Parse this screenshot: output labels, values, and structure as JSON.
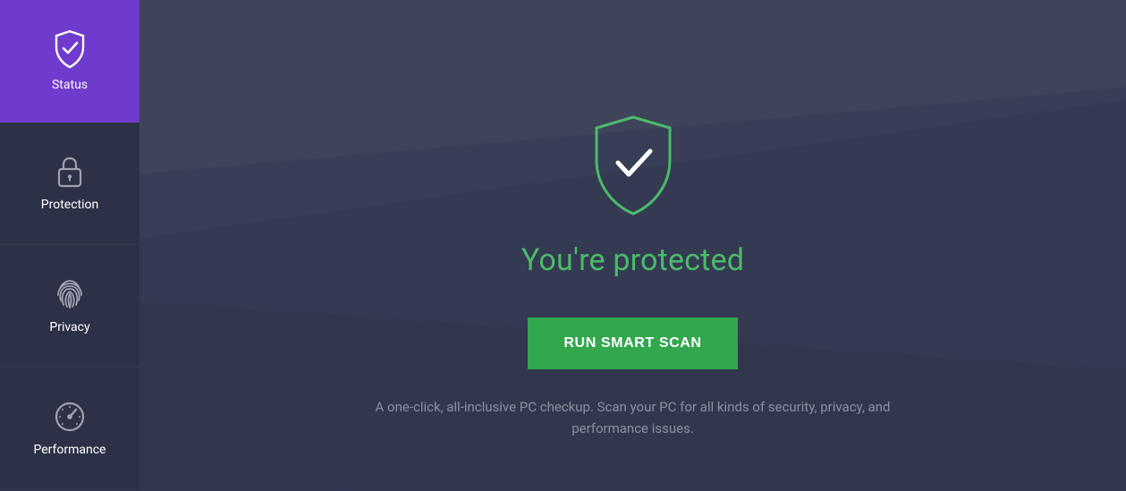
{
  "sidebar": {
    "items": [
      {
        "label": "Status",
        "icon": "shield-check-icon",
        "active": true
      },
      {
        "label": "Protection",
        "icon": "lock-icon",
        "active": false
      },
      {
        "label": "Privacy",
        "icon": "fingerprint-icon",
        "active": false
      },
      {
        "label": "Performance",
        "icon": "gauge-icon",
        "active": false
      }
    ]
  },
  "main": {
    "status_title": "You're protected",
    "scan_button_label": "RUN SMART SCAN",
    "status_description": "A one-click, all-inclusive PC checkup. Scan your PC for all kinds of security, privacy, and performance issues.",
    "accent_color": "#4bbb6a",
    "button_color": "#33a74e"
  }
}
